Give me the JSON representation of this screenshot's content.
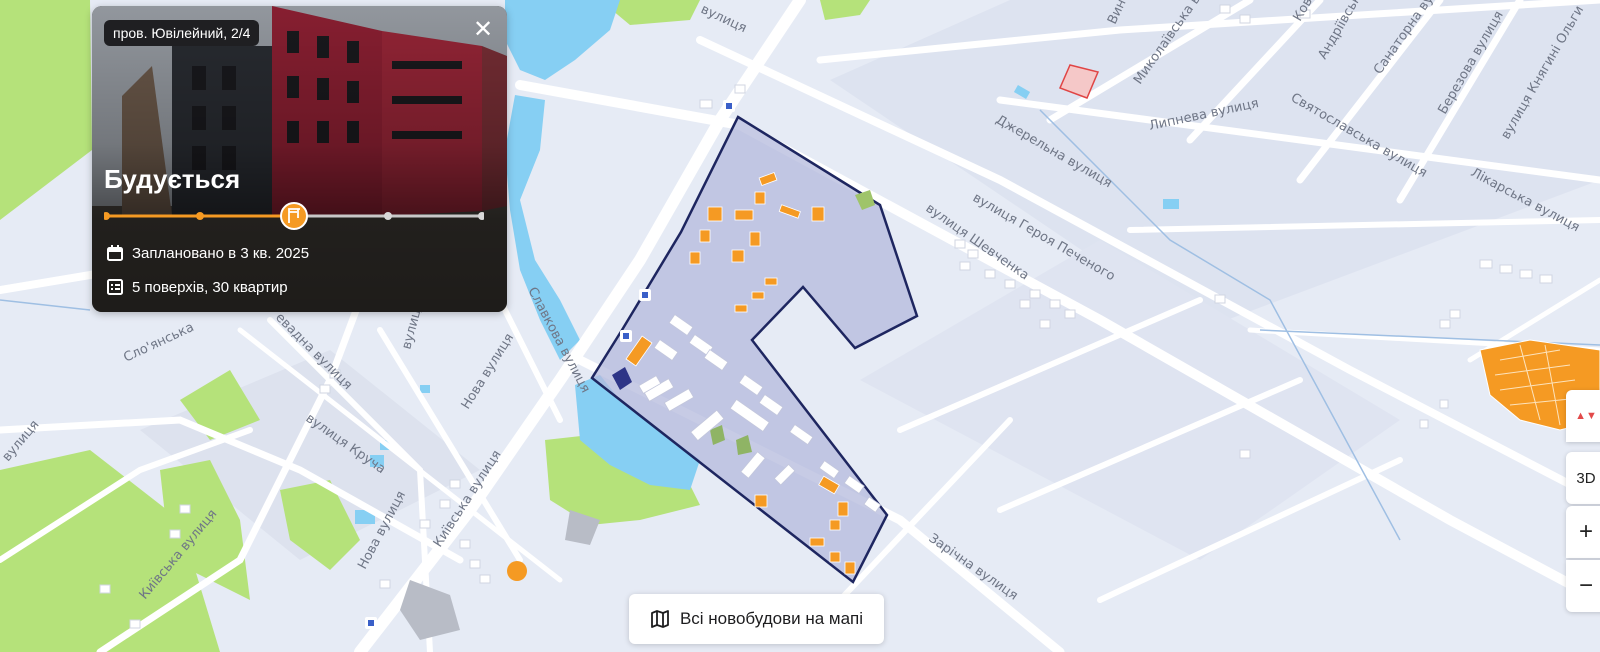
{
  "card": {
    "address": "пров. Ювілейний, 2/4",
    "status": "Будується",
    "planned": "Заплановано в 3 кв. 2025",
    "floors": "5 поверхів, 30 квартир",
    "progress_stage": 3,
    "progress_total": 5,
    "accent": "#f59a23"
  },
  "buttons": {
    "all_new_buildings": "Всі новобудови на мапі",
    "mode_3d": "3D",
    "zoom_in": "+",
    "zoom_out": "−",
    "compass": "▲▼"
  },
  "icons": {
    "close": "close-icon",
    "calendar": "calendar-icon",
    "list": "list-icon",
    "map": "map-icon",
    "bus": "bus-stop-icon"
  },
  "streets": {
    "s1": "Славкова вулиця",
    "s2": "Нова вулиця",
    "s3": "Нова вулиця",
    "s4": "вулиця Круча",
    "s5": "Київська вулиця",
    "s6": "Київська вулиця",
    "s7": "вулиця Шевченка",
    "s8": "вулиця Героя Печеного",
    "s9": "Джерельна вулиця",
    "s10": "Святославська вулиця",
    "s11": "Липнева вулиця",
    "s12": "Миколаївська вулиця",
    "s13": "Лікарська вулиця",
    "s14": "Зарічна вулиця",
    "s15": "Сло'янська",
    "s16": "вулиця",
    "s17": "Санаторна вулиця",
    "s18": "Березова вулиця",
    "s19": "вулиця Княгині Ольги",
    "s20": "Андріївська вулиця",
    "s21": "Виногр",
    "s22": "Ковал",
    "s23": "евадна вулиця",
    "s24": "вулиця",
    "s25": "вулиця"
  },
  "colors": {
    "map_bg": "#e6ebf5",
    "water": "#86cff3",
    "park": "#b5e27a",
    "zone_fill": "#b4b9dc",
    "zone_stroke": "#1e2660",
    "building_orange": "#f59a23",
    "building_navy": "#2e3587"
  }
}
